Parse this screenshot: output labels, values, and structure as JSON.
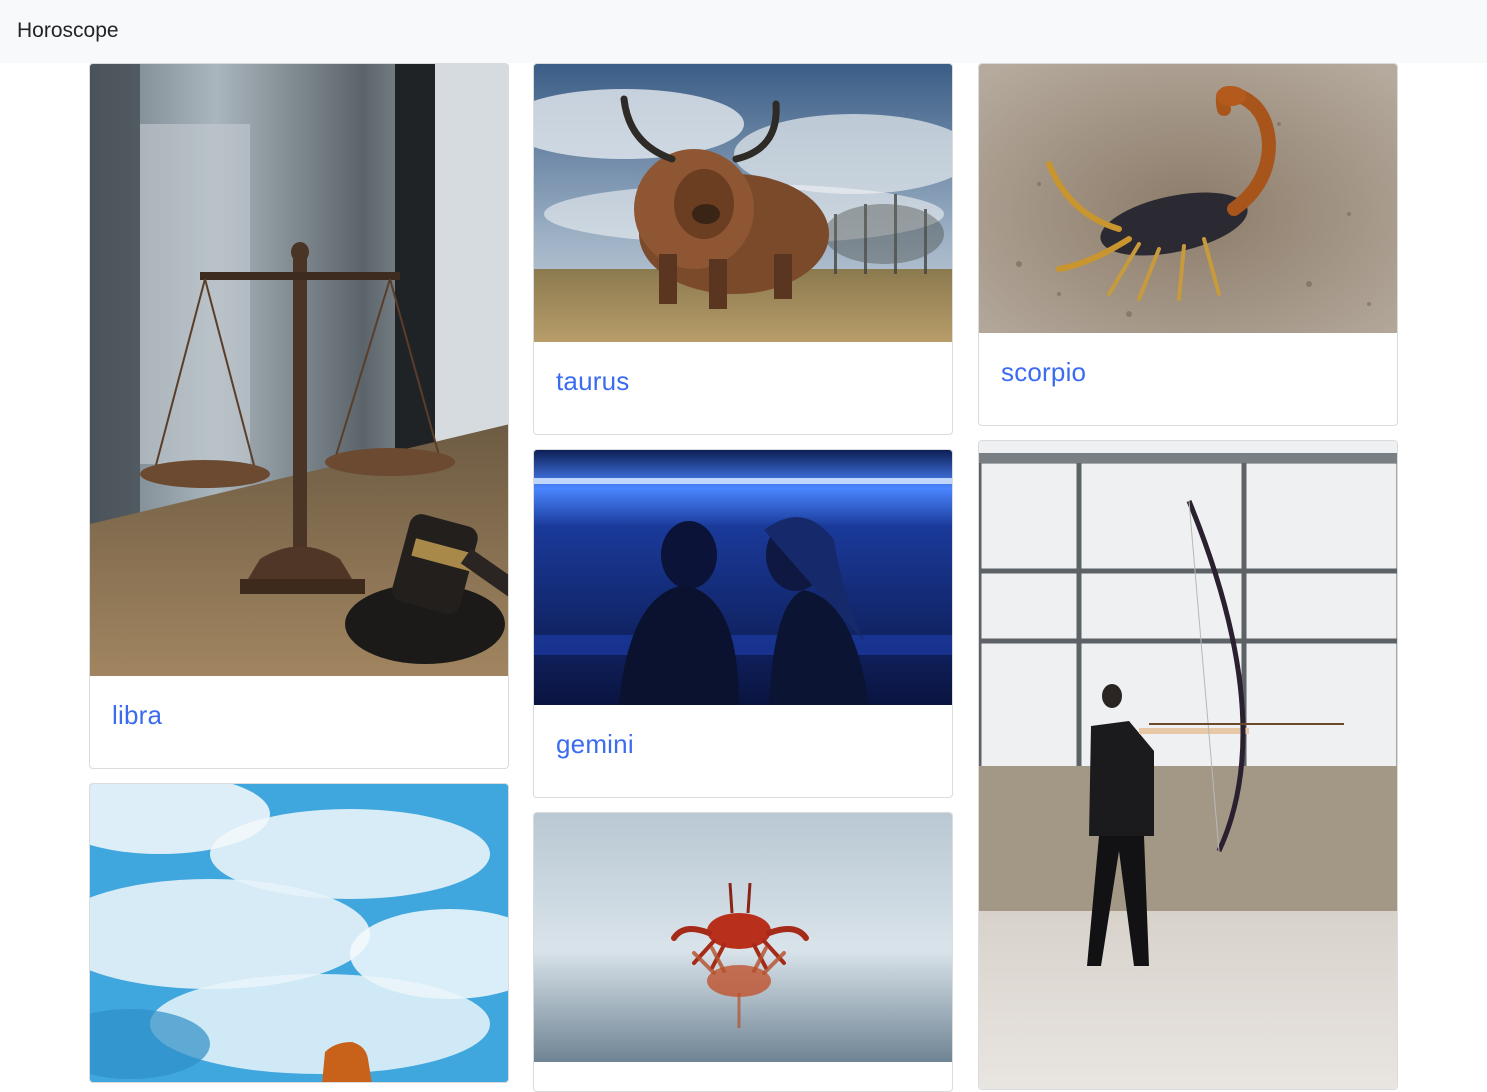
{
  "navbar": {
    "brand": "Horoscope"
  },
  "cards": [
    {
      "id": "libra",
      "title": "libra",
      "image": "libra-scales-photo"
    },
    {
      "id": "taurus",
      "title": "taurus",
      "image": "highland-bull-photo"
    },
    {
      "id": "scorpio",
      "title": "scorpio",
      "image": "scorpion-photo"
    },
    {
      "id": "gemini",
      "title": "gemini",
      "image": "twins-blue-light-photo"
    },
    {
      "id": "sagittarius",
      "title": "",
      "image": "archer-photo"
    },
    {
      "id": "aquarius",
      "title": "",
      "image": "sky-clouds-photo"
    },
    {
      "id": "cancer",
      "title": "",
      "image": "red-crab-photo"
    }
  ],
  "colors": {
    "link": "#3b6cf0",
    "navbar_bg": "#f8f9fa",
    "text": "#212529"
  }
}
